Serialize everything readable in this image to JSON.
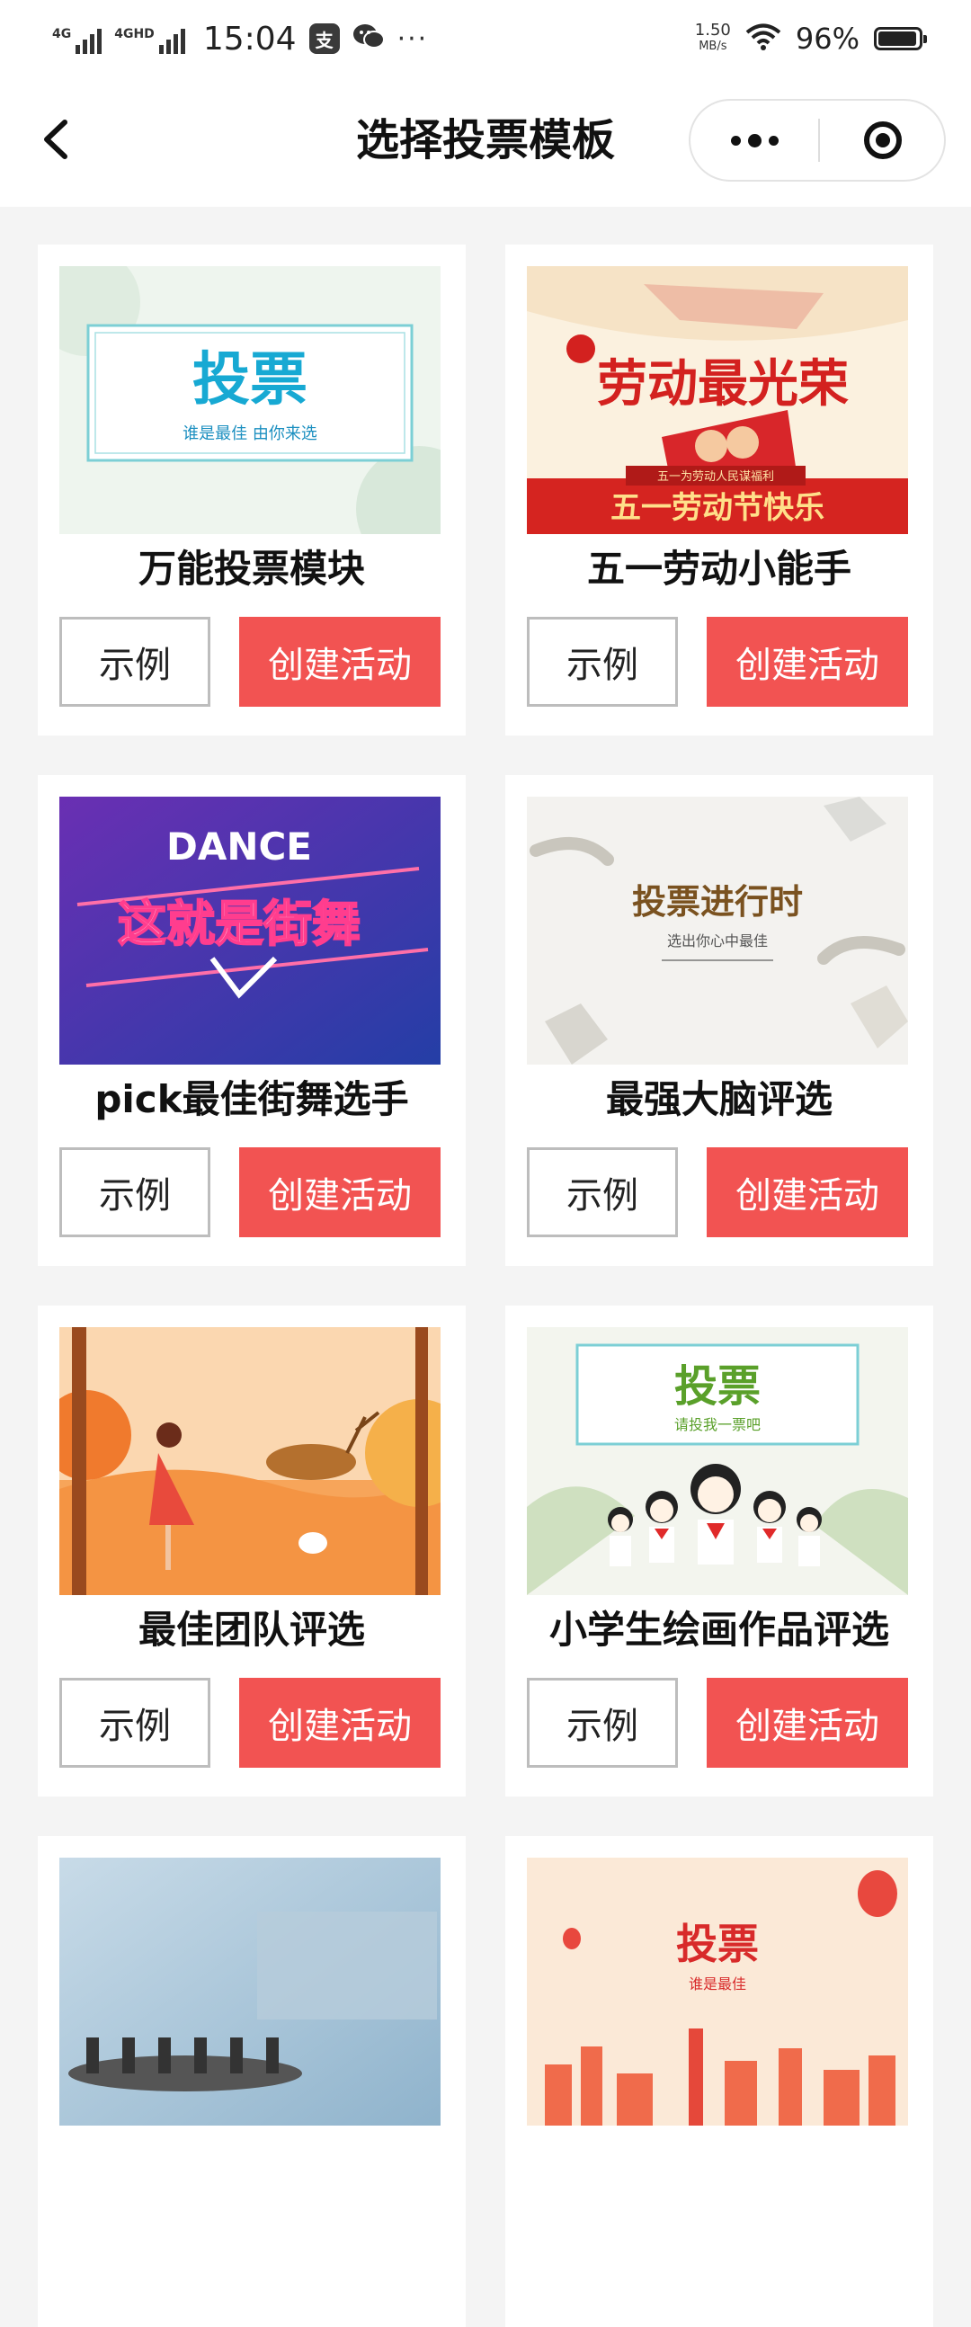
{
  "status_bar": {
    "network_1": "4G",
    "network_2": "4GHD",
    "time": "15:04",
    "app_icon_1": "app-icon",
    "app_icon_2": "wechat-icon",
    "more": "···",
    "speed_value": "1.50",
    "speed_unit": "MB/s",
    "battery_pct": "96%",
    "battery_level": 0.96
  },
  "nav": {
    "title": "选择投票模板",
    "back_icon": "chevron-left-icon",
    "more_icon": "more-dots-icon",
    "close_icon": "target-close-icon"
  },
  "colors": {
    "accent": "#f25352",
    "page_bg": "#f4f4f4",
    "card_bg": "#ffffff"
  },
  "templates": [
    {
      "title": "万能投票模块",
      "example_label": "示例",
      "create_label": "创建活动",
      "thumb_text": "投票",
      "thumb_sub": "谁是最佳 由你来选"
    },
    {
      "title": "五一劳动小能手",
      "example_label": "示例",
      "create_label": "创建活动",
      "thumb_text": "劳动最光荣",
      "thumb_sub": "五一为劳动人民谋福利",
      "thumb_banner": "五一劳动节快乐"
    },
    {
      "title": "pick最佳街舞选手",
      "example_label": "示例",
      "create_label": "创建活动",
      "thumb_text": "DANCE",
      "thumb_sub": "这就是街舞"
    },
    {
      "title": "最强大脑评选",
      "example_label": "示例",
      "create_label": "创建活动",
      "thumb_text": "投票进行时",
      "thumb_sub": "选出你心中最佳"
    },
    {
      "title": "最佳团队评选",
      "example_label": "示例",
      "create_label": "创建活动"
    },
    {
      "title": "小学生绘画作品评选",
      "example_label": "示例",
      "create_label": "创建活动",
      "thumb_text": "投票",
      "thumb_sub": "请投我一票吧"
    },
    {
      "title": "",
      "example_label": "",
      "create_label": ""
    },
    {
      "title": "",
      "example_label": "",
      "create_label": "",
      "thumb_text": "投票",
      "thumb_sub": "谁是最佳"
    }
  ]
}
